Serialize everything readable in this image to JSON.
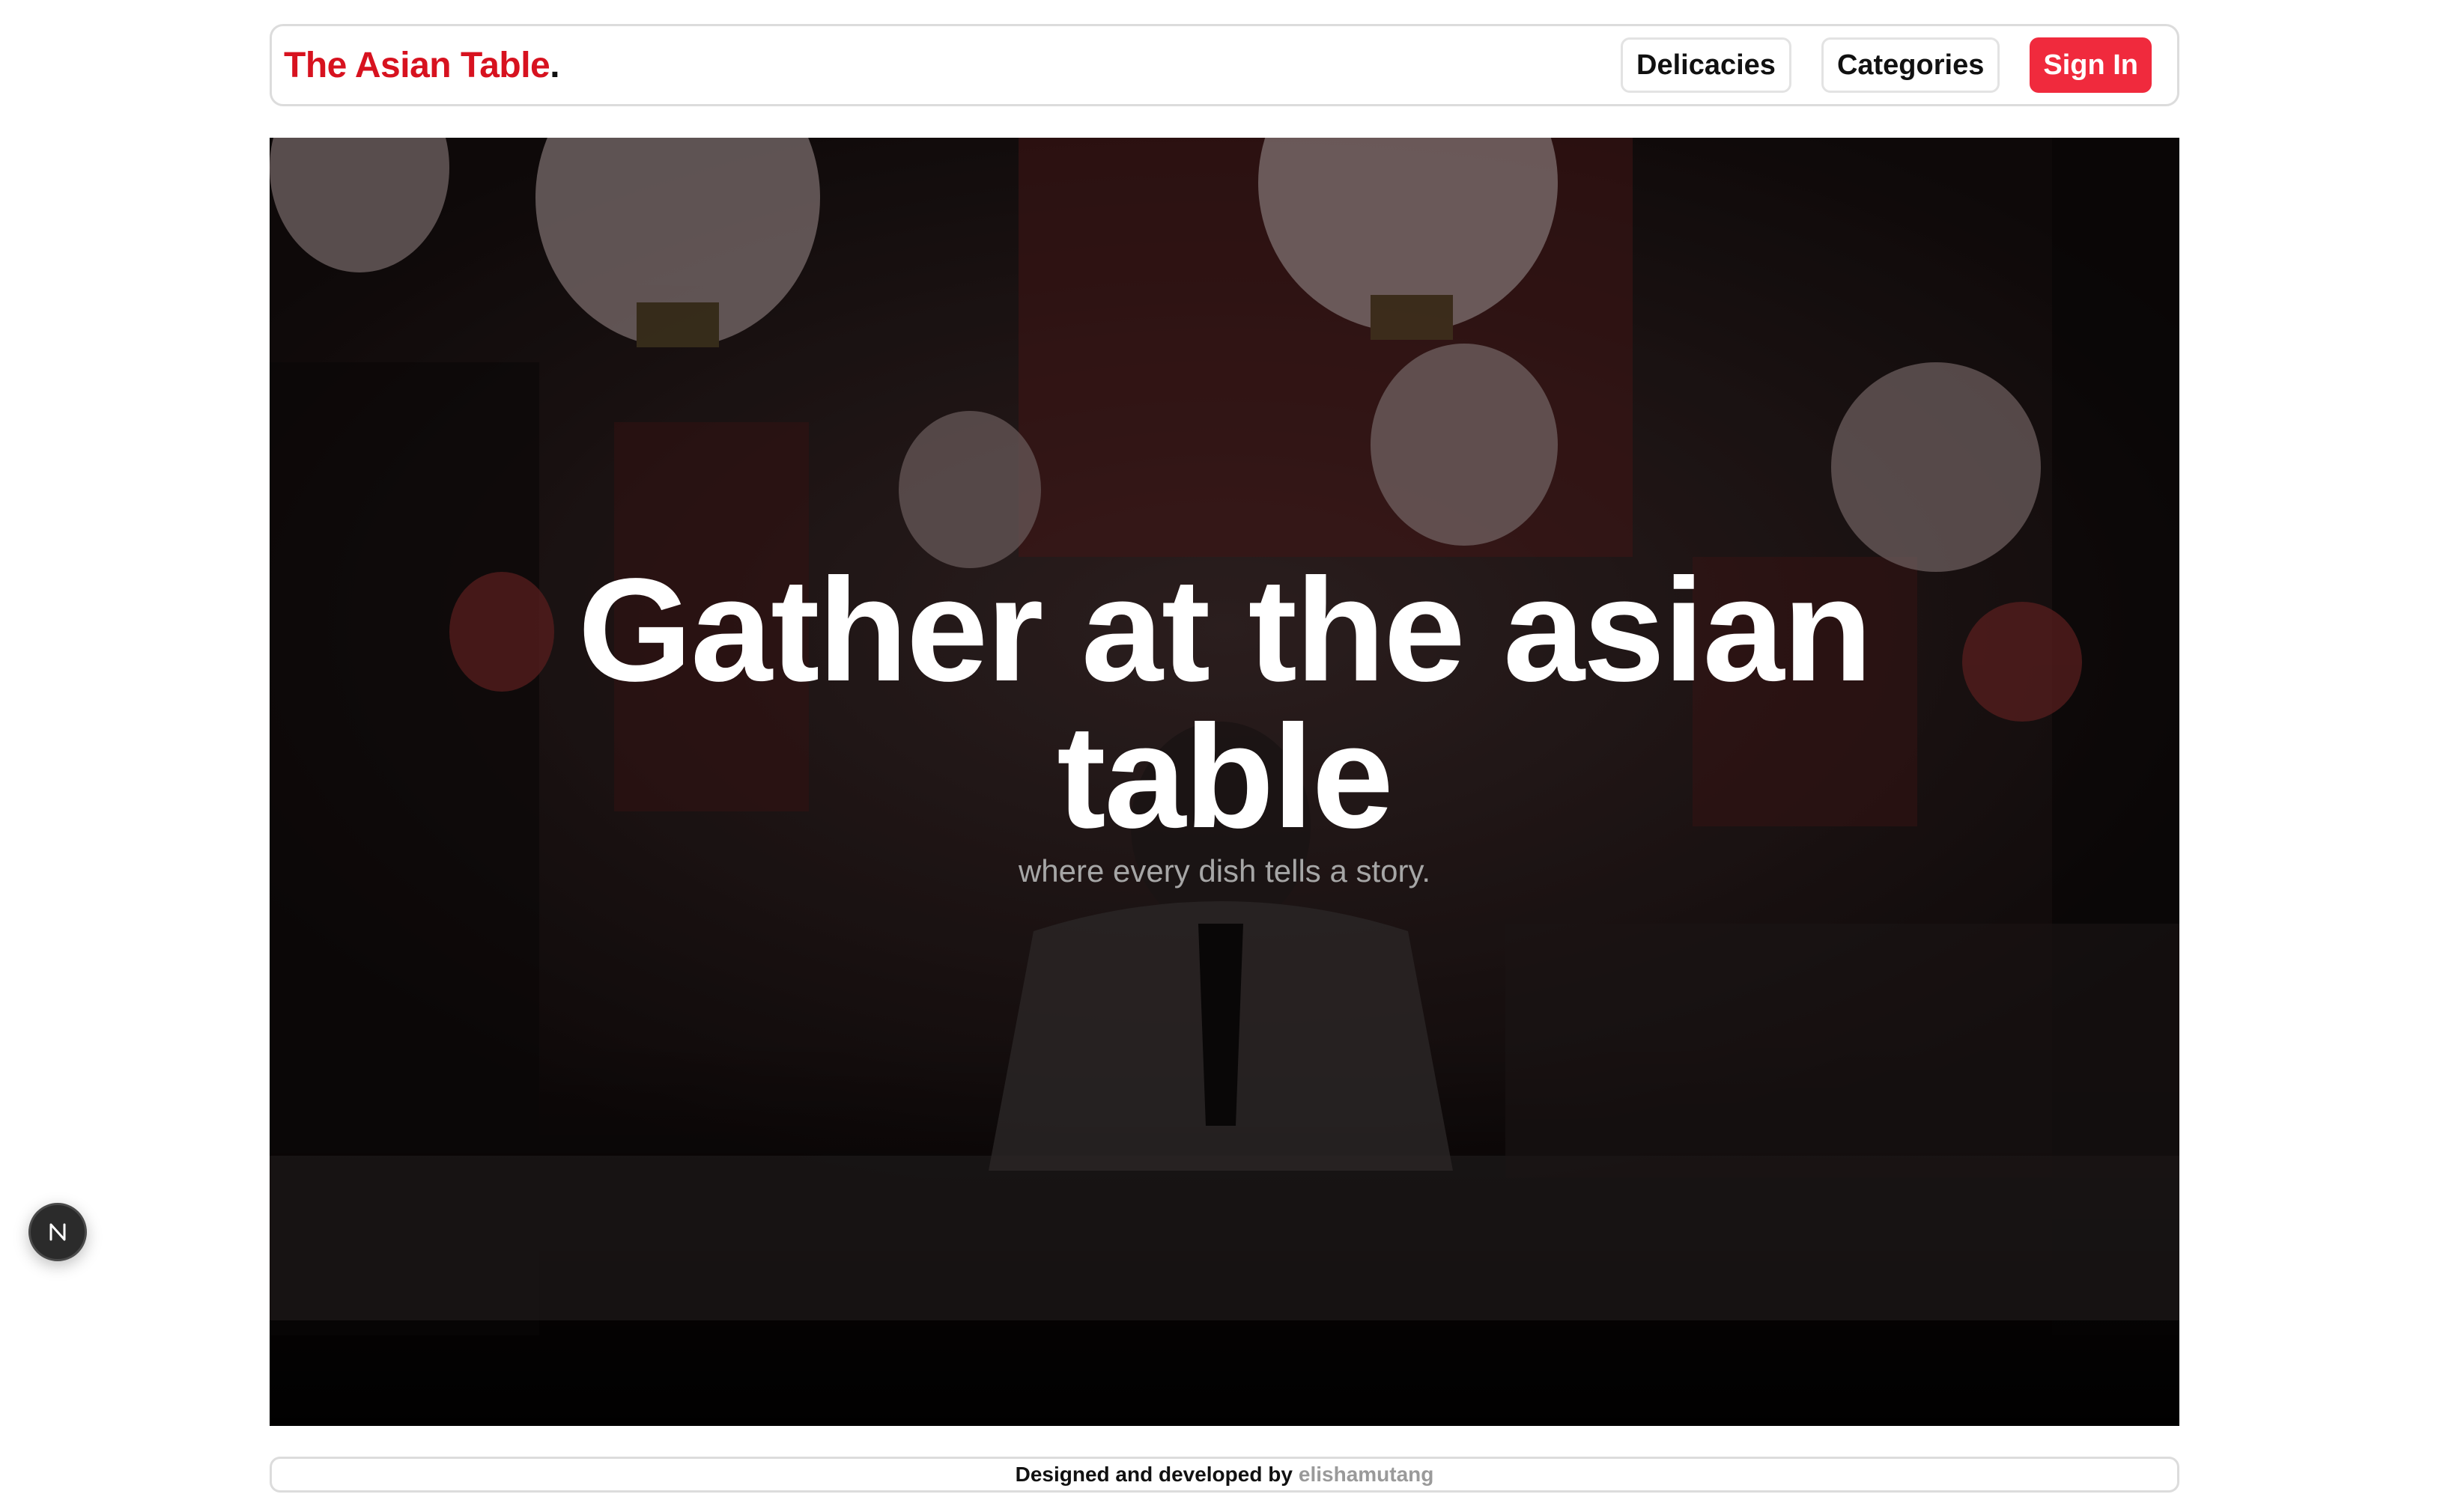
{
  "header": {
    "brand": "The Asian Table",
    "brand_dot": ".",
    "nav": {
      "delicacies": "Delicacies",
      "categories": "Categories",
      "sign_in": "Sign In"
    }
  },
  "hero": {
    "title": "Gather at the asian table",
    "subtitle": "where every dish tells a story."
  },
  "badge": {
    "letter": "N"
  },
  "footer": {
    "credit": "Designed and developed by",
    "author": "elishamutang"
  },
  "colors": {
    "brand": "#d7121f",
    "sign_in_bg": "#f02a3d",
    "subtitle": "#a6a6a6",
    "footer_author": "#9a9a9a"
  }
}
